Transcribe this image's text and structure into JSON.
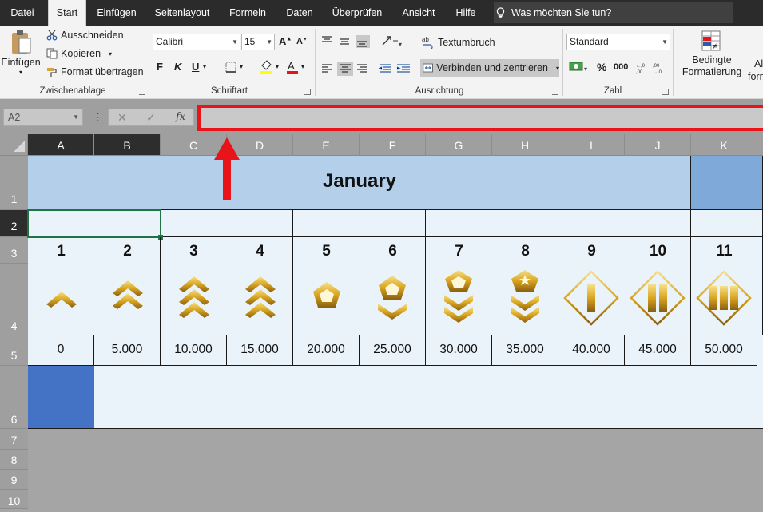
{
  "menu": {
    "tabs": [
      "Datei",
      "Start",
      "Einfügen",
      "Seitenlayout",
      "Formeln",
      "Daten",
      "Überprüfen",
      "Ansicht",
      "Hilfe"
    ],
    "active": "Start",
    "tellme": "Was möchten Sie tun?"
  },
  "ribbon": {
    "clipboard": {
      "paste": "Einfügen",
      "cut": "Ausschneiden",
      "copy": "Kopieren",
      "format_painter": "Format übertragen",
      "label": "Zwischenablage"
    },
    "font": {
      "name": "Calibri",
      "size": "15",
      "bold": "F",
      "italic": "K",
      "underline": "U",
      "label": "Schriftart"
    },
    "alignment": {
      "wrap": "Textumbruch",
      "merge": "Verbinden und zentrieren",
      "label": "Ausrichtung"
    },
    "number": {
      "format": "Standard",
      "percent": "%",
      "thousands": "000",
      "label": "Zahl"
    },
    "styles": {
      "conditional_line1": "Bedingte",
      "conditional_line2": "Formatierung",
      "next_line1": "Al",
      "next_line2": "forn"
    }
  },
  "formula_bar": {
    "name_box": "A2",
    "fx": "fx",
    "cancel": "✕",
    "enter": "✓",
    "content": ""
  },
  "columns": [
    "A",
    "B",
    "C",
    "D",
    "E",
    "F",
    "G",
    "H",
    "I",
    "J",
    "K"
  ],
  "rows": [
    "1",
    "2",
    "3",
    "4",
    "5",
    "6",
    "7",
    "8",
    "9",
    "10"
  ],
  "sheet": {
    "title": "January",
    "levels": [
      "1",
      "2",
      "3",
      "4",
      "5",
      "6",
      "7",
      "8",
      "9",
      "10",
      "11"
    ],
    "values": [
      "0",
      "5.000",
      "10.000",
      "15.000",
      "20.000",
      "25.000",
      "30.000",
      "35.000",
      "40.000",
      "45.000",
      "50.000"
    ]
  },
  "colors": {
    "header_fill": "#b4cfe9",
    "light_fill": "#ebf3fa",
    "blue_fill": "#4472c4",
    "highlight": "#e8141a",
    "gold": "#d9a520"
  }
}
